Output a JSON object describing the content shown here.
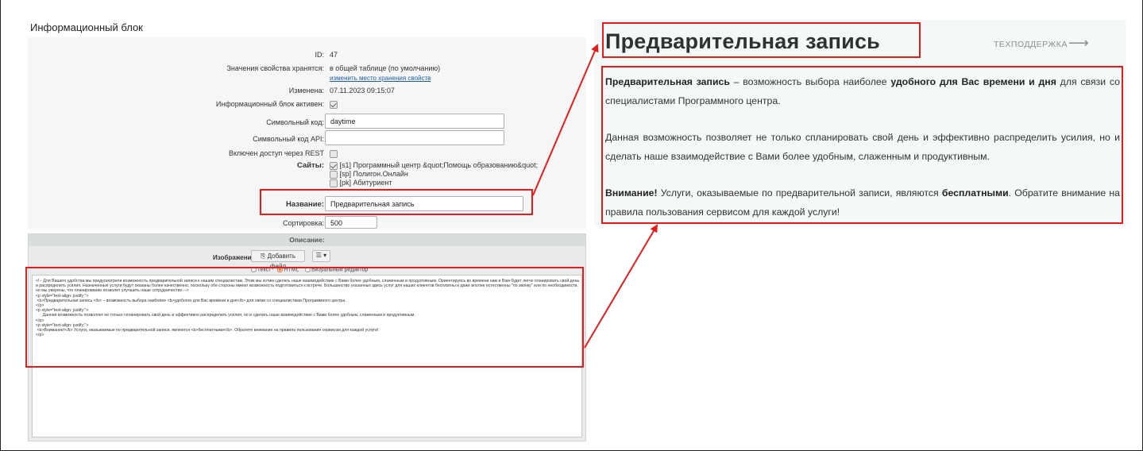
{
  "page_title": "Информационный блок",
  "form": {
    "id_label": "ID:",
    "id_value": "47",
    "storage_label": "Значения свойства хранятся:",
    "storage_value": "в общей таблице (по умолчанию)",
    "storage_link": "изменить место хранения свойств",
    "modified_label": "Изменена:",
    "modified_value": "07.11.2023 09:15:07",
    "active_label": "Информационный блок активен:",
    "code_label": "Символьный код:",
    "code_value": "daytime",
    "api_code_label": "Символьный код API:",
    "api_code_value": "",
    "rest_label": "Включен доступ через REST",
    "sites_label": "Сайты:",
    "sites": [
      "[s1] Программный центр &quot;Помощь образованию&quot;",
      "[sp] Полигон.Онлайн",
      "[pk] Абитуриент"
    ],
    "name_label": "Название:",
    "name_value": "Предварительная запись",
    "sort_label": "Сортировка:",
    "sort_value": "500"
  },
  "description": {
    "header": "Описание:",
    "image_label": "Изображение:",
    "add_file_button": "Добавить файл",
    "menu_button": "☰ ▾",
    "radio_options": [
      "Текст",
      "HTML",
      "Визуальный редактор"
    ],
    "code": "<!-- Для Вашего удобства мы предусмотрели возможность предварительной записи к нашим специалистам. Этим мы хотим сделать наше взаимодействие с Вами более удобным, слаженным и продуктивным. Ориентируясь во времени нам и Вам будет легче планировать свой день и распределить усилия. Назначенные услуги будут оказаны более качественно, поскольку обе стороны имеют возможность подготовиться к встрече. Большинство указанных здесь услуг для наших клиентов бесплатны и даже вполне естественны \"по звонку\" или по необходимости, но мы уверены, что планирование позволит улучшить наше сотрудничество.-->\n<p style=\"text-align: justify;\">\n <b>Предварительная запись </b> – возможность выбора наиболее <b>удобного для Вас времени и дня</b> для связи со специалистами Программного центра.\n</p>\n<p style=\"text-align: justify;\">\n      Данная возможность позволяет не только спланировать свой день и эффективно распределить усилия, но и сделать наше взаимодействие с Вами более удобным, слаженным и продуктивным.\n</p>\n<p style=\"text-align: justify;\">\n <b>Внимание!</b> Услуги, оказываемые по предварительной записи, являются <b>бесплатными</b>. Обратите внимание на правила пользования сервисом для каждой услуги!\n</p>"
  },
  "preview": {
    "title": "Предварительная запись",
    "support_link": "ТЕХПОДДЕРЖКА",
    "arrow": "⟶",
    "p1_bold": "Предварительная запись",
    "p1_text1": " – возможность выбора наиболее ",
    "p1_bold2": "удобного для Вас времени и дня",
    "p1_text2": " для связи со специалистами Программного центра.",
    "p2_text": "Данная возможность позволяет не только спланировать свой день и эффективно распределить усилия, но и сделать наше взаимодействие с Вами более удобным, слаженным и продуктивным.",
    "p3_bold": "Внимание!",
    "p3_text1": " Услуги, оказываемые по предварительной записи, являются ",
    "p3_bold2": "бесплатными",
    "p3_text2": ". Обратите внимание на правила пользования сервисом для каждой услуги!"
  },
  "colors": {
    "annotation_red": "#e81b1b",
    "link_blue": "#1a5fb4",
    "radio_orange": "#e2672b"
  }
}
